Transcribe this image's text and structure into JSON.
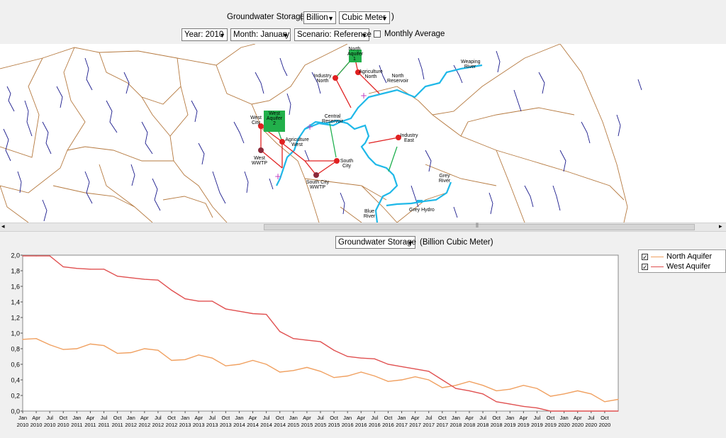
{
  "header": {
    "title": "Groundwater Storage",
    "open_paren": "(",
    "close_paren": ")",
    "unit_scale": "Billion",
    "unit": "Cubic Meter"
  },
  "filters": {
    "year": "Year: 2010",
    "month": "Month: January",
    "scenario": "Scenario: Reference",
    "monthly_average_label": "Monthly Average",
    "monthly_average_checked": false
  },
  "map": {
    "labels": {
      "north_aquifer": "North Aquifer 1",
      "west_aquifer": "West Aquifer 2",
      "weaping_river": "Weaping River",
      "industry_north": "Industry North",
      "agriculture_north": "Agriculture North",
      "north_reservoir": "North Reservoir",
      "west_city": "West City",
      "central_reservoir": "Central Reservoir",
      "agriculture_west": "Agriculture West",
      "industry_east": "Industry East",
      "west_wwtp": "West WWTP",
      "south_city": "South City",
      "south_city_wwtp": "South City WWTP",
      "grey_river": "Grey River",
      "grey_hydro": "Grey Hydro",
      "blue_river": "Blue River"
    },
    "colors": {
      "river": "#1fb8e8",
      "stream": "#1a1a8c",
      "border": "#b5793f",
      "supply": "#e02020",
      "return": "#20b050",
      "aquifer": "#22b04b"
    }
  },
  "chart_controls": {
    "variable": "Groundwater Storage",
    "unit_text": "(Billion Cubic Meter)"
  },
  "legend": {
    "items": [
      {
        "label": "North Aquifer",
        "color": "#f0a060",
        "checked": true
      },
      {
        "label": "West Aquifer",
        "color": "#e05050",
        "checked": true
      }
    ]
  },
  "chart_data": {
    "type": "line",
    "ylim": [
      0,
      2.0
    ],
    "yticks": [
      "0,0",
      "0,2",
      "0,4",
      "0,6",
      "0,8",
      "1,0",
      "1,2",
      "1,4",
      "1,6",
      "1,8",
      "2,0"
    ],
    "xticks_month": [
      "Jan",
      "Apr",
      "Jul",
      "Oct",
      "Jan",
      "Apr",
      "Jul",
      "Oct",
      "Jan",
      "Apr",
      "Jul",
      "Oct",
      "Jan",
      "Apr",
      "Jul",
      "Oct",
      "Jan",
      "Apr",
      "Jul",
      "Oct",
      "Jan",
      "Apr",
      "Jul",
      "Oct",
      "Jan",
      "Apr",
      "Jul",
      "Oct",
      "Jan",
      "Apr",
      "Jul",
      "Oct",
      "Jan",
      "Apr",
      "Jul",
      "Oct",
      "Jan",
      "Apr",
      "Jul",
      "Oct",
      "Jan",
      "Apr",
      "Jul",
      "Oct"
    ],
    "xticks_year": [
      "2010",
      "2010",
      "2010",
      "2010",
      "2011",
      "2011",
      "2011",
      "2011",
      "2012",
      "2012",
      "2012",
      "2012",
      "2013",
      "2013",
      "2013",
      "2013",
      "2014",
      "2014",
      "2014",
      "2014",
      "2015",
      "2015",
      "2015",
      "2015",
      "2016",
      "2016",
      "2016",
      "2016",
      "2017",
      "2017",
      "2017",
      "2017",
      "2018",
      "2018",
      "2018",
      "2018",
      "2019",
      "2019",
      "2019",
      "2019",
      "2020",
      "2020",
      "2020",
      "2020"
    ],
    "series": [
      {
        "name": "North Aquifer",
        "color": "#f0a060",
        "x_quarter": [
          0,
          1,
          2,
          3,
          4,
          5,
          6,
          7,
          8,
          9,
          10,
          11,
          12,
          13,
          14,
          15,
          16,
          17,
          18,
          19,
          20,
          21,
          22,
          23,
          24,
          25,
          26,
          27,
          28,
          29,
          30,
          31,
          32,
          33,
          34,
          35,
          36,
          37,
          38,
          39,
          40,
          41,
          42,
          43,
          44
        ],
        "values": [
          0.92,
          0.93,
          0.85,
          0.79,
          0.8,
          0.86,
          0.84,
          0.74,
          0.75,
          0.8,
          0.78,
          0.65,
          0.66,
          0.72,
          0.68,
          0.58,
          0.6,
          0.65,
          0.6,
          0.5,
          0.52,
          0.56,
          0.51,
          0.43,
          0.45,
          0.5,
          0.45,
          0.38,
          0.4,
          0.44,
          0.4,
          0.3,
          0.33,
          0.38,
          0.33,
          0.26,
          0.28,
          0.33,
          0.29,
          0.19,
          0.22,
          0.26,
          0.22,
          0.12,
          0.15
        ]
      },
      {
        "name": "West Aquifer",
        "color": "#e05050",
        "x_quarter": [
          0,
          1,
          2,
          3,
          4,
          5,
          6,
          7,
          8,
          9,
          10,
          11,
          12,
          13,
          14,
          15,
          16,
          17,
          18,
          19,
          20,
          21,
          22,
          23,
          24,
          25,
          26,
          27,
          28,
          29,
          30,
          31,
          32,
          33,
          34,
          35,
          36,
          37,
          38,
          39,
          40,
          41,
          42,
          43,
          44
        ],
        "values": [
          1.99,
          1.99,
          1.99,
          1.85,
          1.83,
          1.82,
          1.82,
          1.73,
          1.71,
          1.69,
          1.68,
          1.55,
          1.44,
          1.41,
          1.41,
          1.31,
          1.28,
          1.25,
          1.24,
          1.02,
          0.93,
          0.91,
          0.89,
          0.78,
          0.7,
          0.68,
          0.67,
          0.6,
          0.57,
          0.54,
          0.51,
          0.4,
          0.29,
          0.26,
          0.22,
          0.12,
          0.09,
          0.06,
          0.04,
          0.0,
          0.0,
          0.0,
          0.0,
          0.0,
          0.0
        ]
      }
    ]
  }
}
